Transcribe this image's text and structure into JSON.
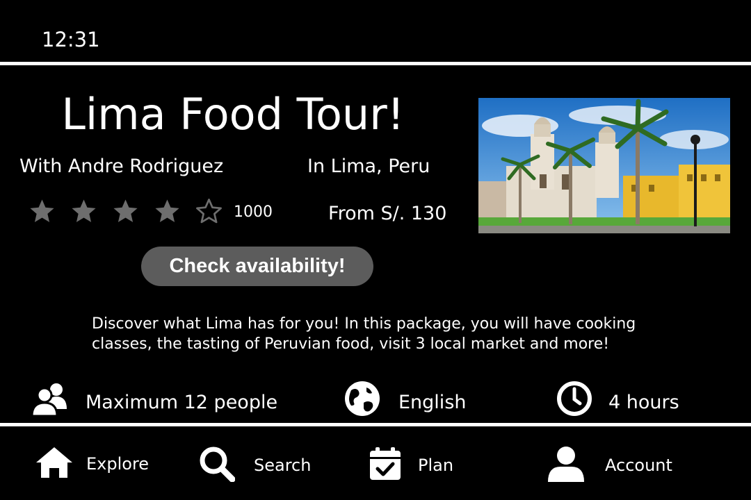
{
  "status_bar": {
    "time": "12:31"
  },
  "tour": {
    "title": "Lima Food Tour!",
    "host": "With Andre Rodriguez",
    "location": "In Lima, Peru",
    "rating": 4,
    "rating_max": 5,
    "review_count": "1000",
    "price": "From S/. 130",
    "cta_label": "Check availability!",
    "description": "Discover what Lima has for you! In this package, you will have cooking classes, the tasting of Peruvian food, visit 3 local market and more!"
  },
  "features": [
    {
      "icon": "group-icon",
      "label": "Maximum 12 people"
    },
    {
      "icon": "globe-icon",
      "label": "English"
    },
    {
      "icon": "clock-icon",
      "label": "4 hours"
    }
  ],
  "bottom_nav": [
    {
      "icon": "home-icon",
      "label": "Explore"
    },
    {
      "icon": "search-icon",
      "label": "Search"
    },
    {
      "icon": "calendar-icon",
      "label": "Plan"
    },
    {
      "icon": "user-icon",
      "label": "Account"
    }
  ],
  "colors": {
    "background": "#000000",
    "foreground": "#ffffff",
    "button": "#5c5c5c",
    "star": "#6e6e6e"
  }
}
